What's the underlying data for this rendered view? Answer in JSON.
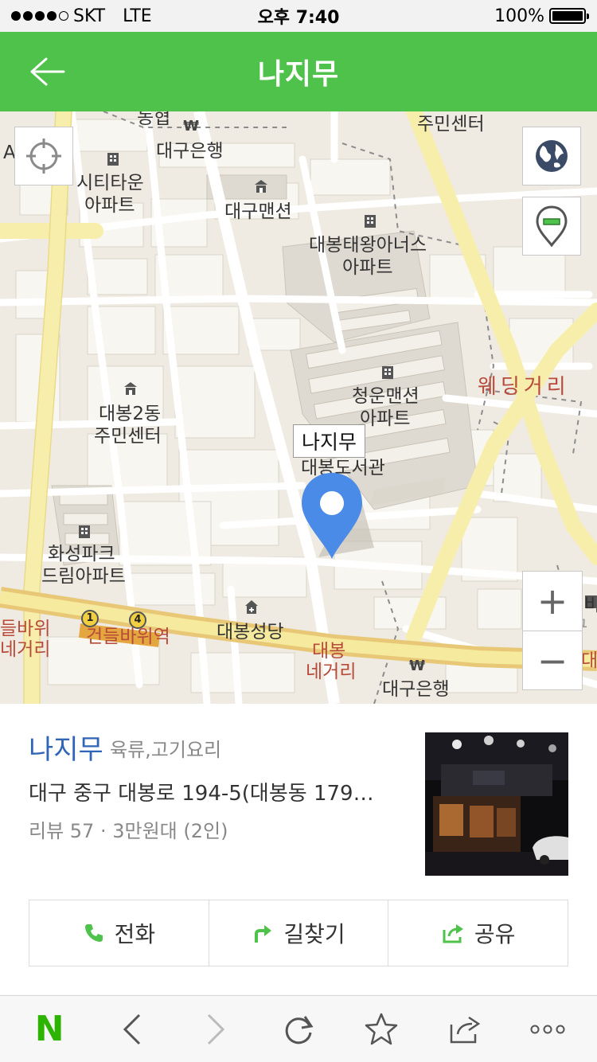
{
  "status_bar": {
    "carrier": "SKT",
    "network": "LTE",
    "time": "오후 7:40",
    "battery": "100%"
  },
  "header": {
    "title": "나지무",
    "back_icon": "back-arrow-icon"
  },
  "map": {
    "controls": {
      "locate_icon": "crosshair-icon",
      "globe_icon": "globe-icon",
      "pin_toggle_icon": "map-pin-icon",
      "zoom_in": "+",
      "zoom_out": "−"
    },
    "callout": "나지무",
    "labels": {
      "top_left": "A",
      "nonghyup": "농협",
      "daegu_bank_top": "대구은행",
      "jumin_center_top": "주민센터",
      "city_town": "시티타운",
      "apt_1": "아파트",
      "daegu_mansion": "대구맨션",
      "daebong_taewang": "대봉태왕아너스",
      "apt_2": "아파트",
      "wedding_street": "웨딩거리",
      "cheongun": "청운맨션",
      "apt_3": "아파트",
      "daebong2dong": "대봉2동",
      "jumin_center": "주민센터",
      "library": "대봉도서관",
      "hwaseong_park": "화성파크",
      "dream_apt": "드림아파트",
      "geondeul_bawi_left": "들바위",
      "negeori_left": "네거리",
      "geondeul_station": "건들바위역",
      "daebong_church": "대봉성당",
      "daebong": "대봉",
      "negeori": "네거리",
      "daegu_bank_bottom": "대구은행",
      "edge_daegu": "대구",
      "edge_ba": "바",
      "edge_dae": "대동"
    },
    "subway_lines": [
      "1",
      "4"
    ],
    "colors": {
      "major_road": "#f7eeac",
      "land": "#efebe2",
      "block": "#f7f5ef",
      "pin": "#4a8be8",
      "header_green": "#4ec24a"
    }
  },
  "place": {
    "name": "나지무",
    "category": "육류,고기요리",
    "address": "대구 중구 대봉로 194-5(대봉동 179…",
    "meta": "리뷰 57 · 3만원대 (2인)"
  },
  "actions": [
    {
      "label": "전화",
      "icon": "phone-icon"
    },
    {
      "label": "길찾기",
      "icon": "directions-icon"
    },
    {
      "label": "공유",
      "icon": "share-icon"
    }
  ],
  "bottom_bar": {
    "items": [
      "naver-logo-icon",
      "back-icon",
      "forward-icon",
      "reload-icon",
      "bookmark-star-icon",
      "share-icon",
      "more-icon"
    ],
    "logo_text": "N"
  }
}
